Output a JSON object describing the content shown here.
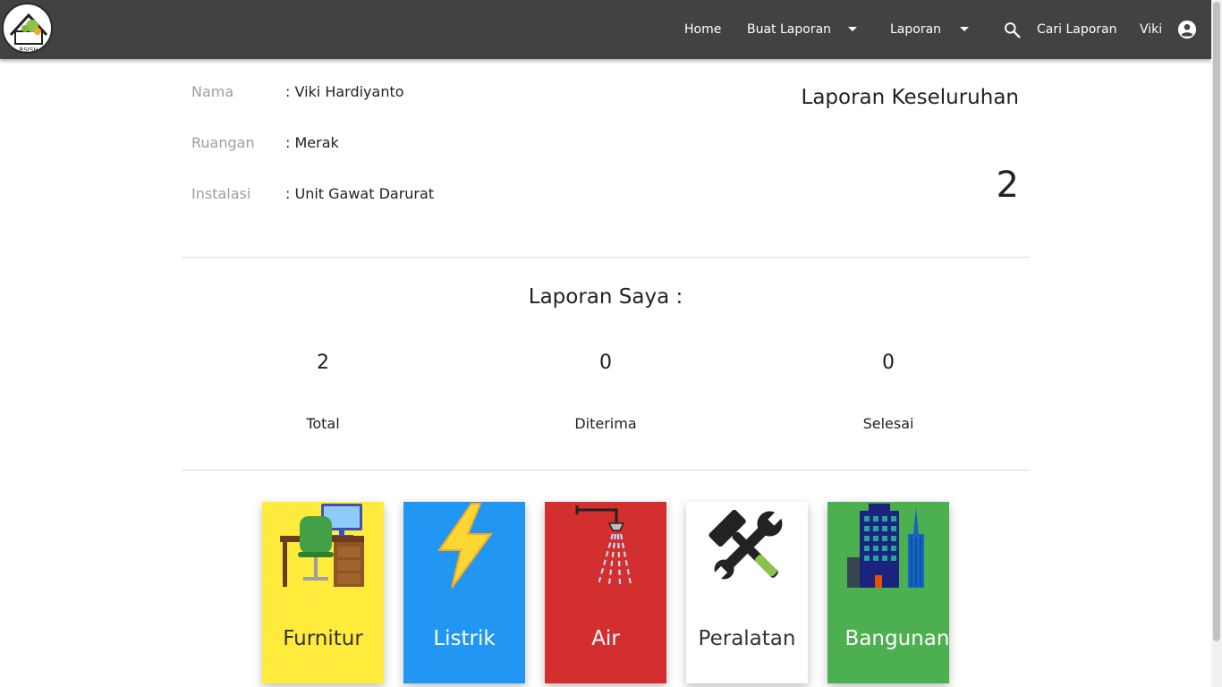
{
  "navbar": {
    "logo_text": "RSJSH",
    "home": "Home",
    "create_report": "Buat Laporan",
    "reports": "Laporan",
    "search_reports": "Cari Laporan",
    "user": "Viki",
    "bg_color": "#424242"
  },
  "profile": {
    "name_label": "Nama",
    "name_value": ": Viki Hardiyanto",
    "room_label": "Ruangan",
    "room_value": ": Merak",
    "installation_label": "Instalasi",
    "installation_value": ": Unit Gawat Darurat"
  },
  "overall": {
    "title": "Laporan Keseluruhan",
    "count": "2"
  },
  "my_reports": {
    "title": "Laporan Saya :",
    "stats": [
      {
        "value": "2",
        "label": "Total"
      },
      {
        "value": "0",
        "label": "Diterima"
      },
      {
        "value": "0",
        "label": "Selesai"
      }
    ]
  },
  "categories": [
    {
      "label": "Furnitur",
      "color": "#ffeb3b",
      "icon": "furniture-icon"
    },
    {
      "label": "Listrik",
      "color": "#2196f3",
      "icon": "lightning-icon"
    },
    {
      "label": "Air",
      "color": "#d32f2f",
      "icon": "shower-icon"
    },
    {
      "label": "Peralatan",
      "color": "#ffffff",
      "icon": "tools-icon"
    },
    {
      "label": "Bangunan",
      "color": "#4caf50",
      "icon": "building-icon"
    }
  ]
}
